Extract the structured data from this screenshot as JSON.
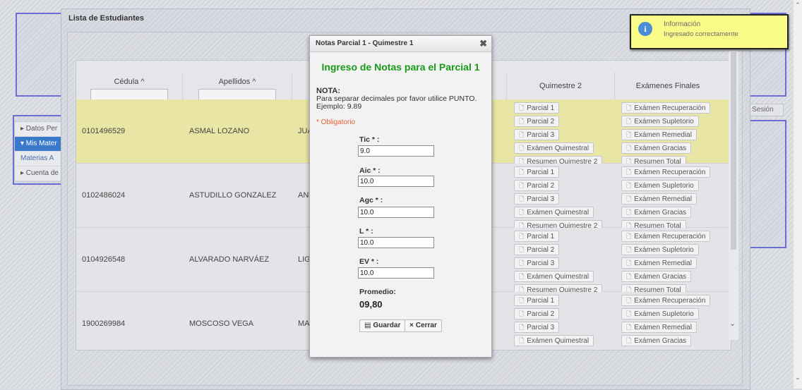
{
  "list_panel": {
    "title": "Lista de Estudiantes"
  },
  "side_menu": {
    "items": [
      {
        "label": "▸ Datos Per",
        "active": false
      },
      {
        "label": "▾ Mis Mater",
        "active": true
      },
      {
        "label": "Materias A",
        "active": false
      },
      {
        "label": "▸ Cuenta de",
        "active": false
      }
    ]
  },
  "logout": {
    "label": "r Sesión"
  },
  "table": {
    "headers": {
      "cedula": "Cédula ^",
      "apellidos": "Apellidos ^",
      "quimestre2": "Quimestre 2",
      "examenes": "Exámenes Finales"
    },
    "q2_buttons": [
      "Parcial 1",
      "Parcial 2",
      "Parcial 3",
      "Exámen Quimestral",
      "Resumen Quimestre 2"
    ],
    "exam_buttons": [
      "Exámen Recuperación",
      "Exámen Supletorio",
      "Exámen Remedial",
      "Exámen Gracias",
      "Resumen Total"
    ],
    "rows": [
      {
        "cedula": "0101496529",
        "apellidos": "ASMAL LOZANO",
        "nombres": "JUA",
        "selected": true
      },
      {
        "cedula": "0102486024",
        "apellidos": "ASTUDILLO GONZALEZ",
        "nombres": "ANT",
        "selected": false
      },
      {
        "cedula": "0104926548",
        "apellidos": "ALVARADO NARVÁEZ",
        "nombres": "LIG",
        "selected": false
      },
      {
        "cedula": "1900269984",
        "apellidos": "MOSCOSO VEGA",
        "nombres": "MAR",
        "selected": false
      }
    ]
  },
  "modal": {
    "header": "Notas Parcial 1 - Quimestre 1",
    "close_symbol": "✖",
    "title": "Ingreso de Notas para el Parcial 1",
    "note_heading": "NOTA:",
    "note_text": "Para separar decimales por favor utilice PUNTO. Ejemplo: 9.89",
    "required_note": "* Obligatorio",
    "fields": [
      {
        "label": "Tic * :",
        "value": "9.0"
      },
      {
        "label": "Aic * :",
        "value": "10.0"
      },
      {
        "label": "Agc * :",
        "value": "10.0"
      },
      {
        "label": "L * :",
        "value": "10.0"
      },
      {
        "label": "EV * :",
        "value": "10.0"
      }
    ],
    "promedio_label": "Promedio:",
    "promedio_value": "09,80",
    "save_label": "Guardar",
    "close_label": "Cerrar"
  },
  "toast": {
    "title": "Información",
    "message": "Ingresado correctamente",
    "icon": "info-icon"
  },
  "colors": {
    "modal_title": "#1a9a1a",
    "required": "#e0623a",
    "selected_row": "#e9e6a5",
    "toast_bg": "#fbfb8a",
    "accent_border": "#6b6fd4"
  }
}
